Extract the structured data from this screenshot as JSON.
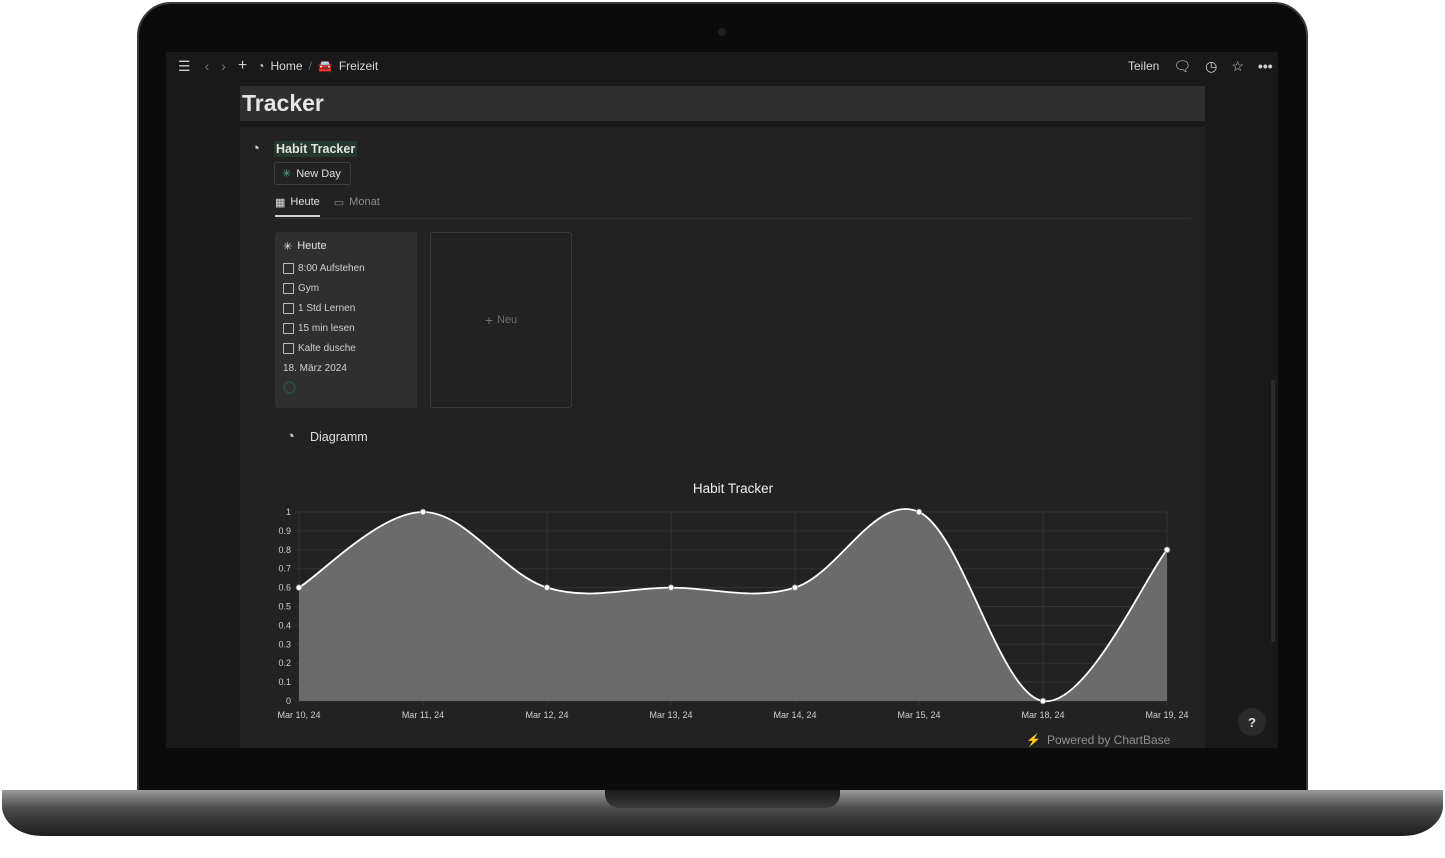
{
  "topbar": {
    "breadcrumb": [
      {
        "label": "Home",
        "icon": "chartbase-logo-icon"
      },
      {
        "label": "Freizeit",
        "icon": "car-icon"
      }
    ],
    "separator": "/",
    "share_label": "Teilen"
  },
  "page": {
    "title": "Tracker"
  },
  "database": {
    "title": "Habit Tracker",
    "new_day_button": "New Day",
    "tabs": [
      {
        "label": "Heute",
        "icon": "gallery-icon",
        "active": true
      },
      {
        "label": "Monat",
        "icon": "calendar-icon",
        "active": false
      }
    ],
    "card": {
      "title": "Heute",
      "items": [
        "8:00 Aufstehen",
        "Gym",
        "1 Std Lernen",
        "15 min lesen",
        "Kalte dusche"
      ],
      "date": "18. März 2024"
    },
    "new_label": "Neu"
  },
  "chart_block": {
    "title": "Diagramm",
    "powered_by": "Powered by ChartBase"
  },
  "help_label": "?",
  "colors": {
    "accent_green": "#4caf7a",
    "title_highlight": "#24382d",
    "area_fill": "#6b6b6b",
    "line": "#ffffff",
    "bolt": "#f5a623"
  },
  "chart_data": {
    "type": "area",
    "title": "Habit Tracker",
    "categories": [
      "Mar 10, 24",
      "Mar 11, 24",
      "Mar 12, 24",
      "Mar 13, 24",
      "Mar 14, 24",
      "Mar 15, 24",
      "Mar 18, 24",
      "Mar 19, 24"
    ],
    "values": [
      0.6,
      1,
      0.6,
      0.6,
      0.6,
      1,
      0,
      0.8
    ],
    "ylim": [
      0,
      1
    ],
    "yticks": [
      "0",
      "0.1",
      "0.2",
      "0.3",
      "0.4",
      "0.5",
      "0.6",
      "0.7",
      "0.8",
      "0.9",
      "1"
    ],
    "grid": true,
    "smooth": true
  }
}
